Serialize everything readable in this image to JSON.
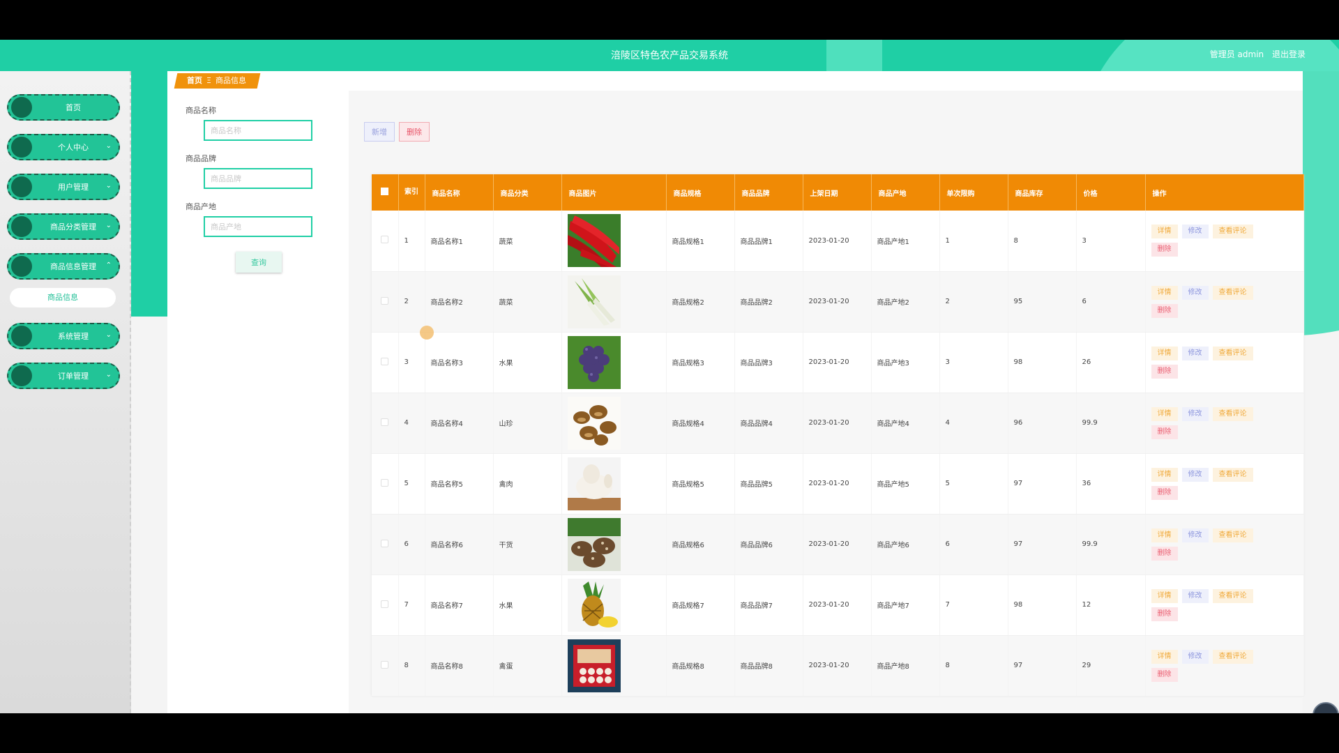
{
  "header": {
    "title": "涪陵区特色农产品交易系统",
    "user_label": "管理员 admin",
    "logout": "退出登录"
  },
  "sidebar": {
    "items": [
      {
        "label": "首页",
        "has_chevron": false
      },
      {
        "label": "个人中心",
        "has_chevron": true
      },
      {
        "label": "用户管理",
        "has_chevron": true
      },
      {
        "label": "商品分类管理",
        "has_chevron": true
      },
      {
        "label": "商品信息管理",
        "has_chevron": true,
        "expanded": true
      },
      {
        "label": "系统管理",
        "has_chevron": true
      },
      {
        "label": "订单管理",
        "has_chevron": true
      }
    ],
    "submenu": {
      "label": "商品信息"
    }
  },
  "breadcrumb": {
    "home": "首页",
    "separator": "Ξ",
    "current": "商品信息"
  },
  "search": {
    "name_label": "商品名称",
    "name_placeholder": "商品名称",
    "brand_label": "商品品牌",
    "brand_placeholder": "商品品牌",
    "origin_label": "商品产地",
    "origin_placeholder": "商品产地",
    "query_button": "查询"
  },
  "toolbar": {
    "add": "新增",
    "delete": "删除"
  },
  "table": {
    "headers": [
      "索引",
      "商品名称",
      "商品分类",
      "商品图片",
      "商品规格",
      "商品品牌",
      "上架日期",
      "商品产地",
      "单次限购",
      "商品库存",
      "价格",
      "操作"
    ],
    "actions": {
      "detail": "详情",
      "edit": "修改",
      "review": "查看评论",
      "remove": "删除"
    },
    "rows": [
      {
        "index": "1",
        "name": "商品名称1",
        "category": "蔬菜",
        "spec": "商品规格1",
        "brand": "商品品牌1",
        "date": "2023-01-20",
        "origin": "商品产地1",
        "limit": "1",
        "stock": "8",
        "price": "3",
        "image": "red-chili"
      },
      {
        "index": "2",
        "name": "商品名称2",
        "category": "蔬菜",
        "spec": "商品规格2",
        "brand": "商品品牌2",
        "date": "2023-01-20",
        "origin": "商品产地2",
        "limit": "2",
        "stock": "95",
        "price": "6",
        "image": "leek"
      },
      {
        "index": "3",
        "name": "商品名称3",
        "category": "水果",
        "spec": "商品规格3",
        "brand": "商品品牌3",
        "date": "2023-01-20",
        "origin": "商品产地3",
        "limit": "3",
        "stock": "98",
        "price": "26",
        "image": "grapes"
      },
      {
        "index": "4",
        "name": "商品名称4",
        "category": "山珍",
        "spec": "商品规格4",
        "brand": "商品品牌4",
        "date": "2023-01-20",
        "origin": "商品产地4",
        "limit": "4",
        "stock": "96",
        "price": "99.9",
        "image": "mushrooms-dried"
      },
      {
        "index": "5",
        "name": "商品名称5",
        "category": "禽肉",
        "spec": "商品规格5",
        "brand": "商品品牌5",
        "date": "2023-01-20",
        "origin": "商品产地5",
        "limit": "5",
        "stock": "97",
        "price": "36",
        "image": "chicken"
      },
      {
        "index": "6",
        "name": "商品名称6",
        "category": "干货",
        "spec": "商品规格6",
        "brand": "商品品牌6",
        "date": "2023-01-20",
        "origin": "商品产地6",
        "limit": "6",
        "stock": "97",
        "price": "99.9",
        "image": "shiitake"
      },
      {
        "index": "7",
        "name": "商品名称7",
        "category": "水果",
        "spec": "商品规格7",
        "brand": "商品品牌7",
        "date": "2023-01-20",
        "origin": "商品产地7",
        "limit": "7",
        "stock": "98",
        "price": "12",
        "image": "pineapple"
      },
      {
        "index": "8",
        "name": "商品名称8",
        "category": "禽蛋",
        "spec": "商品规格8",
        "brand": "商品品牌8",
        "date": "2023-01-20",
        "origin": "商品产地8",
        "limit": "8",
        "stock": "97",
        "price": "29",
        "image": "egg-box"
      }
    ]
  },
  "colors": {
    "primary": "#1fcfa5",
    "header_orange": "#f08a05",
    "danger": "#ea5d70"
  }
}
